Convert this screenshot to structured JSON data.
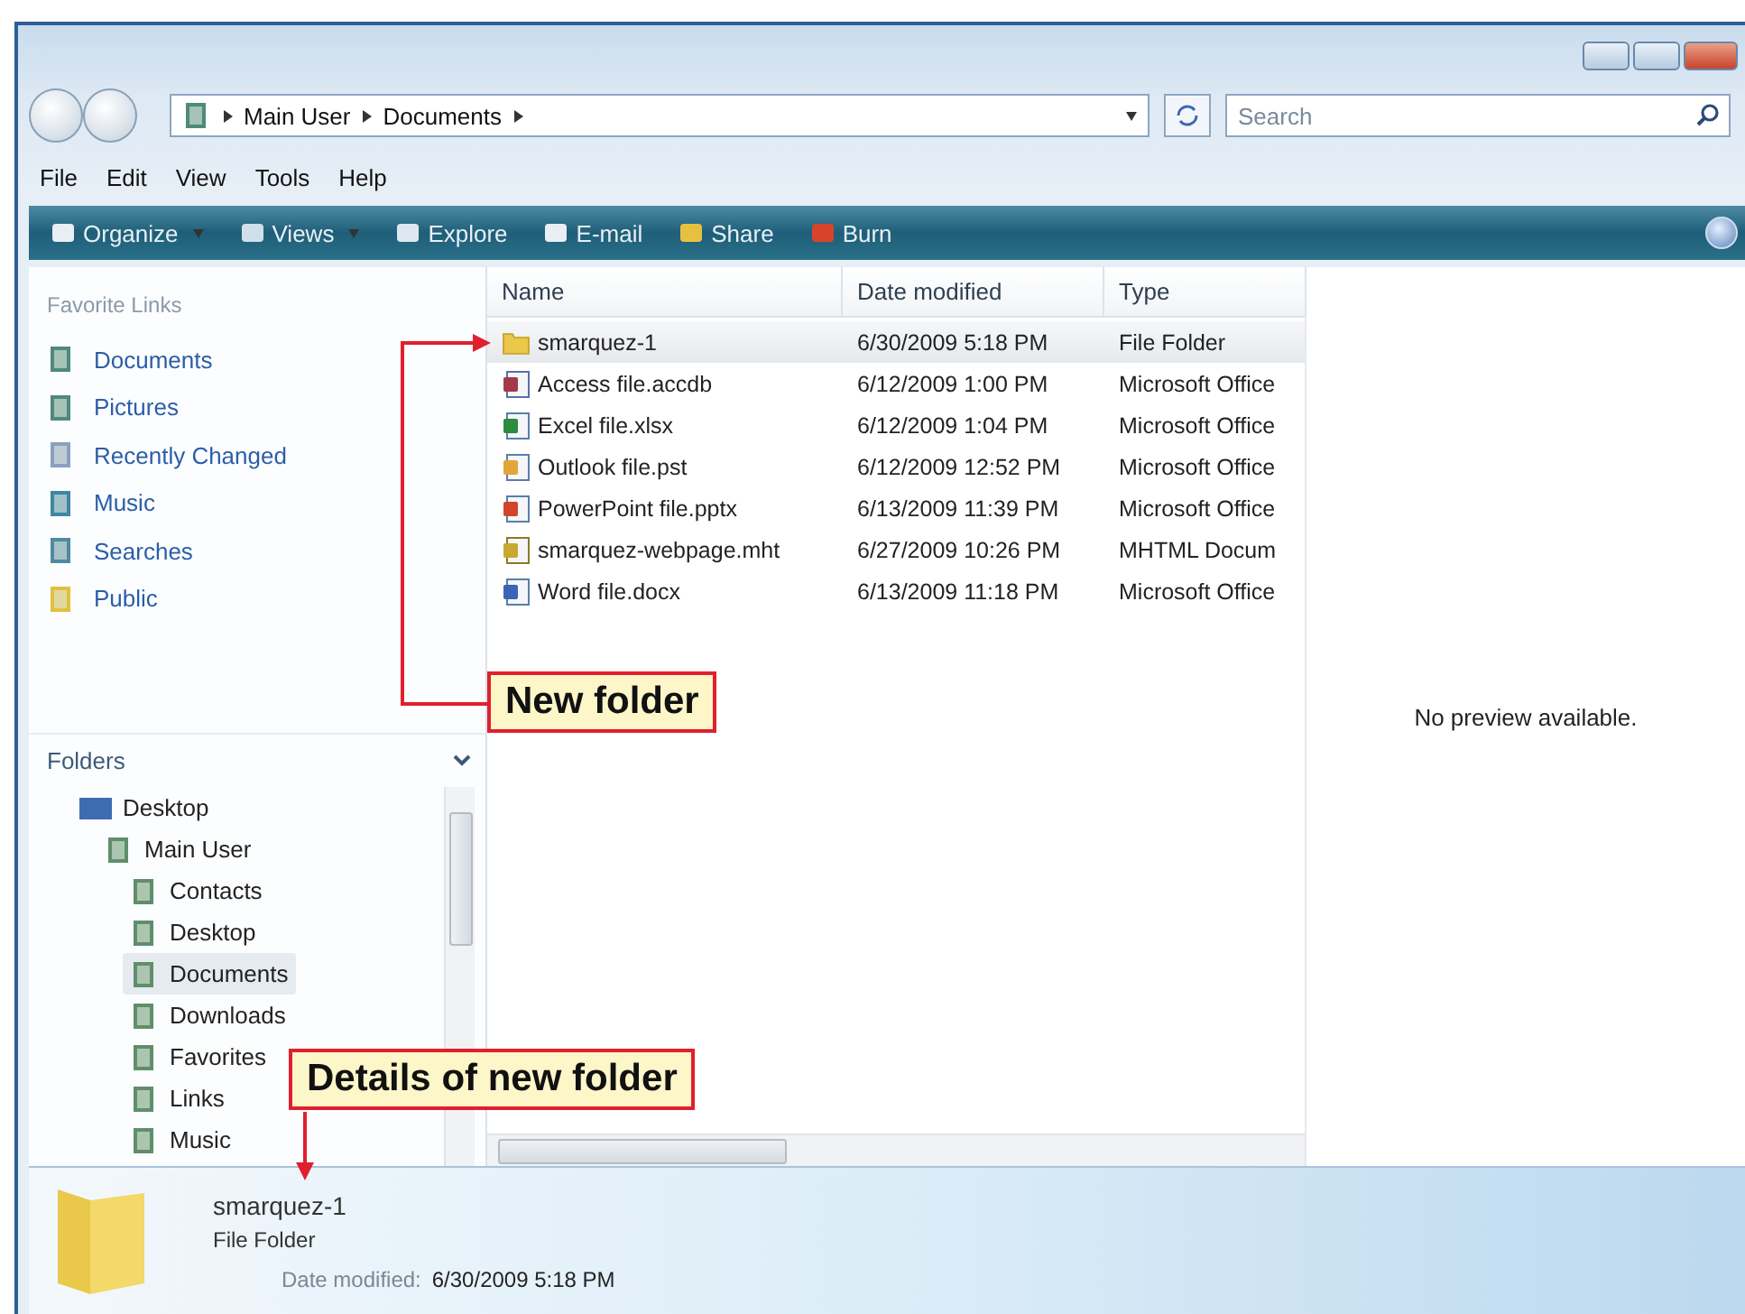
{
  "address_bar": {
    "path": [
      "Main User",
      "Documents"
    ]
  },
  "search": {
    "placeholder": "Search"
  },
  "menu_bar": [
    "File",
    "Edit",
    "View",
    "Tools",
    "Help"
  ],
  "command_bar": [
    {
      "label": "Organize",
      "dropdown": true
    },
    {
      "label": "Views",
      "dropdown": true
    },
    {
      "label": "Explore",
      "dropdown": false
    },
    {
      "label": "E-mail",
      "dropdown": false
    },
    {
      "label": "Share",
      "dropdown": false
    },
    {
      "label": "Burn",
      "dropdown": false
    }
  ],
  "favorite_links": {
    "title": "Favorite Links",
    "items": [
      "Documents",
      "Pictures",
      "Recently Changed",
      "Music",
      "Searches",
      "Public"
    ]
  },
  "folders": {
    "title": "Folders",
    "tree": [
      {
        "label": "Desktop",
        "selected": false,
        "children": [
          {
            "label": "Main User",
            "selected": false,
            "children": [
              {
                "label": "Contacts",
                "selected": false
              },
              {
                "label": "Desktop",
                "selected": false
              },
              {
                "label": "Documents",
                "selected": true
              },
              {
                "label": "Downloads",
                "selected": false
              },
              {
                "label": "Favorites",
                "selected": false
              },
              {
                "label": "Links",
                "selected": false
              },
              {
                "label": "Music",
                "selected": false
              }
            ]
          }
        ]
      }
    ]
  },
  "file_list": {
    "columns": [
      "Name",
      "Date modified",
      "Type"
    ],
    "rows": [
      {
        "kind": "folder",
        "name": "smarquez-1",
        "date": "6/30/2009 5:18 PM",
        "type": "File Folder",
        "selected": true
      },
      {
        "kind": "access",
        "name": "Access file.accdb",
        "date": "6/12/2009 1:00 PM",
        "type": "Microsoft Office",
        "selected": false
      },
      {
        "kind": "excel",
        "name": "Excel file.xlsx",
        "date": "6/12/2009 1:04 PM",
        "type": "Microsoft Office",
        "selected": false
      },
      {
        "kind": "outlook",
        "name": "Outlook file.pst",
        "date": "6/12/2009 12:52 PM",
        "type": "Microsoft Office",
        "selected": false
      },
      {
        "kind": "powerpoint",
        "name": "PowerPoint file.pptx",
        "date": "6/13/2009 11:39 PM",
        "type": "Microsoft Office",
        "selected": false
      },
      {
        "kind": "webpage",
        "name": "smarquez-webpage.mht",
        "date": "6/27/2009 10:26 PM",
        "type": "MHTML Docum",
        "selected": false
      },
      {
        "kind": "word",
        "name": "Word file.docx",
        "date": "6/13/2009 11:18 PM",
        "type": "Microsoft Office",
        "selected": false
      }
    ]
  },
  "preview": {
    "message": "No preview available."
  },
  "details_pane": {
    "name": "smarquez-1",
    "type": "File Folder",
    "date_label": "Date modified:",
    "date_value": "6/30/2009 5:18 PM"
  },
  "callouts": [
    "New folder",
    "Details of new folder"
  ]
}
